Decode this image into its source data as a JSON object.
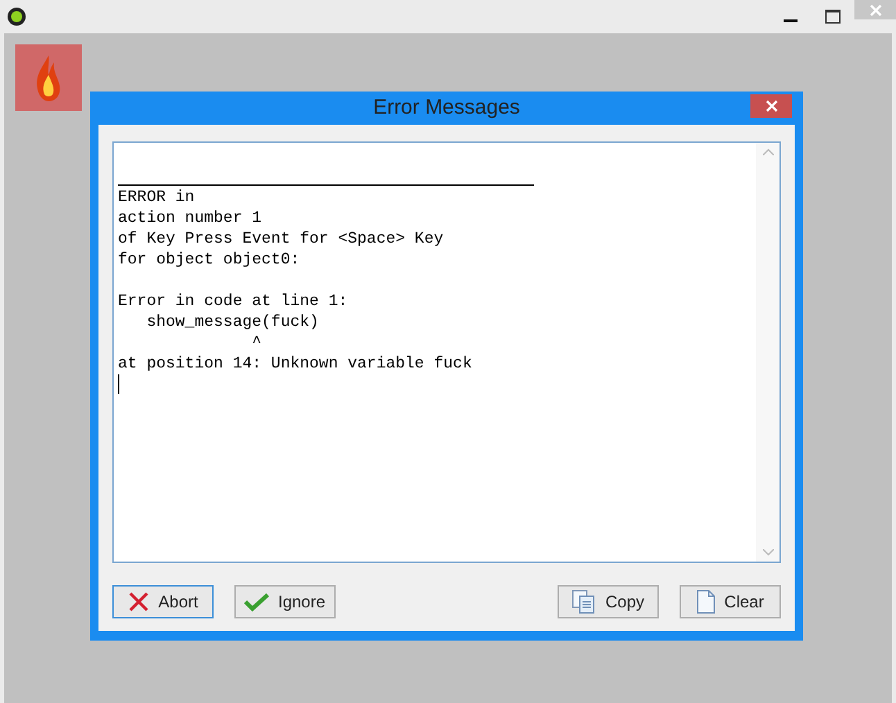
{
  "dialog": {
    "title": "Error Messages",
    "lines": [
      {
        "kind": "blank"
      },
      {
        "kind": "rule"
      },
      {
        "kind": "text",
        "text": "ERROR in"
      },
      {
        "kind": "text",
        "text": "action number 1"
      },
      {
        "kind": "text",
        "text": "of Key Press Event for <Space> Key"
      },
      {
        "kind": "text",
        "text": "for object object0:"
      },
      {
        "kind": "blank"
      },
      {
        "kind": "text",
        "text": "Error in code at line 1:"
      },
      {
        "kind": "text",
        "text": "   show_message(fuck)"
      },
      {
        "kind": "text",
        "text": "              ^"
      },
      {
        "kind": "text",
        "text": "at position 14: Unknown variable fuck"
      }
    ],
    "buttons": [
      {
        "label": "Abort",
        "kind": "abort",
        "focused": true
      },
      {
        "label": "Ignore",
        "kind": "ignore",
        "focused": false
      },
      {
        "label": "Copy",
        "kind": "copy",
        "focused": false
      },
      {
        "label": "Clear",
        "kind": "clear",
        "focused": false
      }
    ]
  }
}
